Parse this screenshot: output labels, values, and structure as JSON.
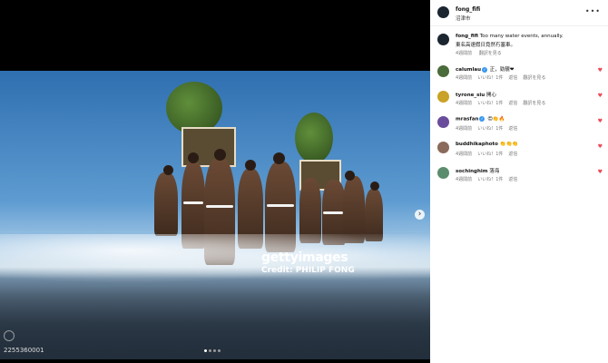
{
  "post": {
    "author": "fong_fifi",
    "location": "沼津市",
    "caption_user": "fong_fifi",
    "caption_line1": "Too many water events, annually.",
    "caption_line2": "東名高速假日竟然冇塞車。",
    "caption_time": "4週間前",
    "caption_translate": "翻訳を見る"
  },
  "photo": {
    "watermark": "gettyimages",
    "credit": "Credit: PHILIP FONG",
    "image_id": "2255360001",
    "carousel_total": 4,
    "carousel_active": 1
  },
  "comments": [
    {
      "user": "calumlau",
      "verified": true,
      "text": "正，勁靚",
      "emoji": "❤",
      "time": "4週間前",
      "likes": "いいね！1件",
      "reply": "返信",
      "translate": "翻訳を見る",
      "avatar_color": "#4a6b3a"
    },
    {
      "user": "tyrone_siu",
      "verified": false,
      "text": "開心",
      "emoji": "",
      "time": "4週間前",
      "likes": "いいね！1件",
      "reply": "返信",
      "translate": "翻訳を見る",
      "avatar_color": "#c9a227"
    },
    {
      "user": "mrasfan",
      "verified": true,
      "text": "",
      "emoji": "😍👏🔥",
      "time": "4週間前",
      "likes": "いいね！1件",
      "reply": "返信",
      "translate": "",
      "avatar_color": "#6a4c9c"
    },
    {
      "user": "buddhikaphoto",
      "verified": false,
      "text": "",
      "emoji": "👏👏👏",
      "time": "4週間前",
      "likes": "いいね！1件",
      "reply": "返信",
      "translate": "",
      "avatar_color": "#8a6a5a"
    },
    {
      "user": "sochinghim",
      "verified": false,
      "text": "落海",
      "emoji": "",
      "time": "4週間前",
      "likes": "いいね！1件",
      "reply": "返信",
      "translate": "",
      "avatar_color": "#5b8c6e"
    }
  ],
  "icons": {
    "menu": "more-horizontal-icon",
    "heart": "heart-icon",
    "next": "chevron-right-icon"
  },
  "colors": {
    "heart": "#ed4956",
    "verified": "#3897f0"
  }
}
